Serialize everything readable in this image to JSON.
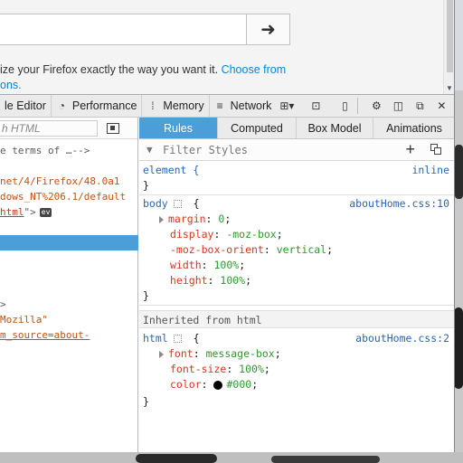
{
  "page": {
    "go_button_glyph": "➜",
    "promo_text": "ize your Firefox exactly the way you want it.",
    "promo_link": "Choose from",
    "promo_line2": "ons."
  },
  "toolbar": {
    "tabs": [
      {
        "label": "le Editor",
        "icon": "style-editor-icon"
      },
      {
        "label": "Performance",
        "icon": "performance-icon"
      },
      {
        "label": "Memory",
        "icon": "memory-icon"
      },
      {
        "label": "Network",
        "icon": "network-icon"
      }
    ]
  },
  "markup": {
    "search_placeholder": "h HTML",
    "lines": [
      {
        "parts": [
          {
            "t": "e terms of …-->",
            "c": "gray"
          }
        ]
      },
      {
        "parts": []
      },
      {
        "parts": [
          {
            "t": "net/4/Firefox/48.0a1",
            "c": "orange"
          }
        ]
      },
      {
        "parts": [
          {
            "t": "dows_NT%206.1/default",
            "c": "orange"
          }
        ]
      },
      {
        "parts": [
          {
            "t": "html",
            "c": "red ul"
          },
          {
            "t": "\">",
            "c": "gray"
          }
        ],
        "ev": "ev"
      },
      {
        "parts": []
      },
      {
        "parts": [],
        "selected": true
      },
      {
        "parts": []
      },
      {
        "parts": []
      },
      {
        "parts": []
      },
      {
        "parts": [
          {
            "t": ">",
            "c": "gray"
          }
        ]
      },
      {
        "parts": [
          {
            "t": "Mozilla\"",
            "c": "orange"
          }
        ]
      },
      {
        "parts": [
          {
            "t": "m_source=about-",
            "c": "orange ul"
          }
        ]
      }
    ]
  },
  "rules": {
    "tabs": [
      "Rules",
      "Computed",
      "Box Model",
      "Animations"
    ],
    "active_tab": "Rules",
    "filter_placeholder": "Filter Styles",
    "add_button": "+",
    "element_rule": {
      "selector": "element {",
      "source": "inline",
      "close": "}"
    },
    "body_rule": {
      "selector": "body",
      "open": "{",
      "source": "aboutHome.css:10",
      "decls": [
        {
          "name": "margin",
          "value": "0",
          "expander": true
        },
        {
          "name": "display",
          "value": "-moz-box"
        },
        {
          "name": "-moz-box-orient",
          "value": "vertical"
        },
        {
          "name": "width",
          "value": "100%"
        },
        {
          "name": "height",
          "value": "100%"
        }
      ],
      "close": "}"
    },
    "inherited_label": "Inherited from html",
    "html_rule": {
      "selector": "html",
      "open": "{",
      "source": "aboutHome.css:2",
      "decls": [
        {
          "name": "font",
          "value": "message-box",
          "expander": true
        },
        {
          "name": "font-size",
          "value": "100%"
        },
        {
          "name": "color",
          "value": "#000",
          "swatch": "#000000"
        }
      ],
      "close": "}"
    }
  },
  "colors": {
    "selection": "#4c9ed9",
    "property": "#d6361f",
    "value": "#2c9a2c",
    "link": "#2b65b0"
  }
}
